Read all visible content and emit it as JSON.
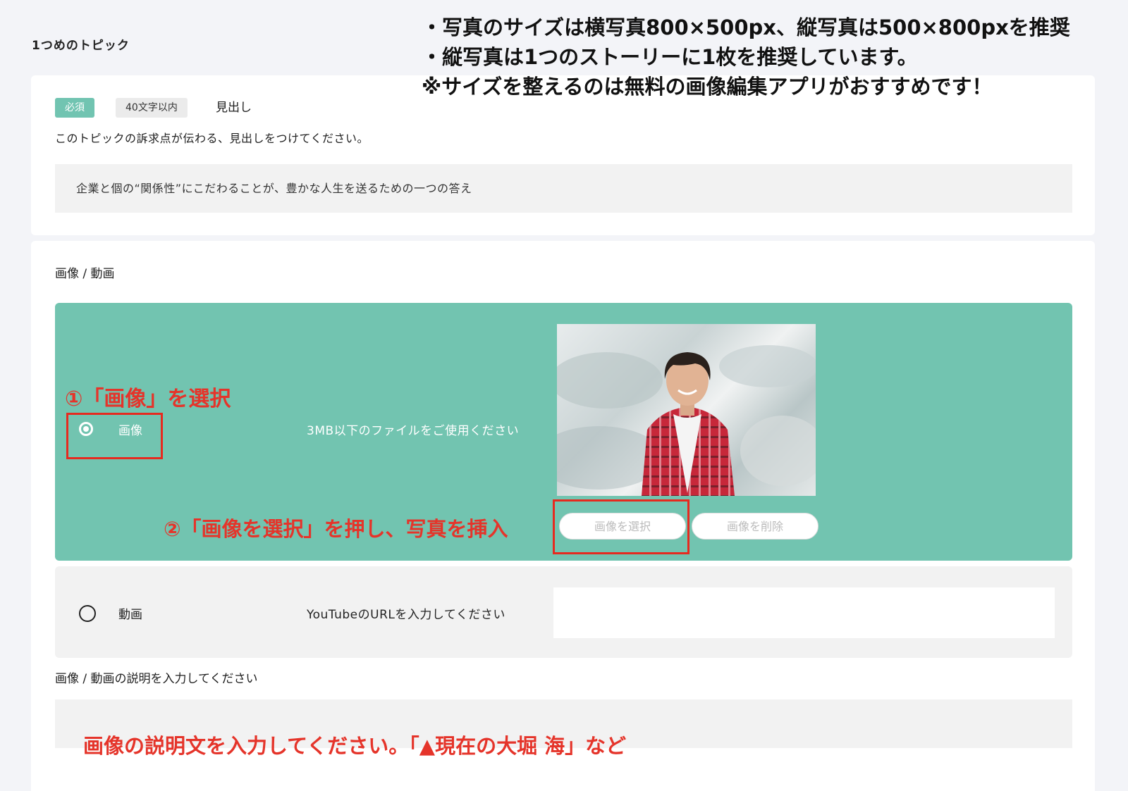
{
  "topic_title": "1つめのトピック",
  "notes": [
    "・写真のサイズは横写真800×500px、縦写真は500×800pxを推奨",
    "・縦写真は1つのストーリーに1枚を推奨しています。",
    "※サイズを整えるのは無料の画像編集アプリがおすすめです！"
  ],
  "heading_card": {
    "required_badge": "必須",
    "length_badge": "40文字以内",
    "label": "見出し",
    "description": "このトピックの訴求点が伝わる、見出しをつけてください。",
    "value": "企業と個の“関係性”にこだわることが、豊かな人生を送るための一つの答え"
  },
  "media_card": {
    "label": "画像 / 動画",
    "image_option": {
      "label": "画像",
      "selected": true,
      "hint": "3MB以下のファイルをご使用ください",
      "select_button": "画像を選択",
      "delete_button": "画像を削除"
    },
    "video_option": {
      "label": "動画",
      "selected": false,
      "hint": "YouTubeのURLを入力してください",
      "url_value": ""
    },
    "caption_label": "画像 / 動画の説明を入力してください",
    "caption_value": ""
  },
  "annotations": {
    "step1": "①「画像」を選択",
    "step2": "②「画像を選択」を押し、写真を挿入",
    "step3": "画像の説明文を入力してください。「▲現在の大堀 海」など"
  },
  "colors": {
    "accent": "#72c4b0",
    "annotation_red": "#e5342a",
    "page_bg": "#f3f4f8"
  }
}
